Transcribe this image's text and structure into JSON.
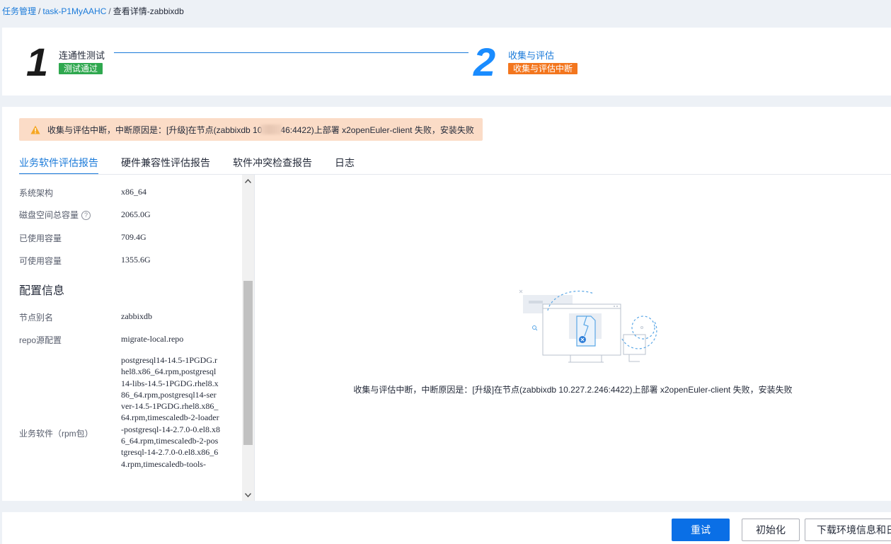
{
  "breadcrumb": {
    "items": [
      "任务管理",
      "task-P1MyAAHC",
      "查看详情-zabbixdb"
    ],
    "separator": "/"
  },
  "steps": [
    {
      "number": "1",
      "title": "连通性测试",
      "badge": "测试通过",
      "badge_color": "#2fa84f"
    },
    {
      "number": "2",
      "title": "收集与评估",
      "badge": "收集与评估中断",
      "badge_color": "#f3761e"
    }
  ],
  "alert": {
    "icon": "warning-icon",
    "text_before": "收集与评估中断，中断原因是：[升级]在节点(zabbixdb 10",
    "text_after": "46:4422)上部署 x2openEuler-client 失败，安装失败"
  },
  "tabs": [
    {
      "label": "业务软件评估报告",
      "active": true
    },
    {
      "label": "硬件兼容性评估报告",
      "active": false
    },
    {
      "label": "软件冲突检查报告",
      "active": false
    },
    {
      "label": "日志",
      "active": false
    }
  ],
  "info": {
    "arch_label": "系统架构",
    "arch_value": "x86_64",
    "disk_total_label": "磁盘空间总容量",
    "disk_total_value": "2065.0G",
    "disk_used_label": "已使用容量",
    "disk_used_value": "709.4G",
    "disk_free_label": "可使用容量",
    "disk_free_value": "1355.6G",
    "config_title": "配置信息",
    "alias_label": "节点别名",
    "alias_value": "zabbixdb",
    "repo_label": "repo源配置",
    "repo_value": "migrate-local.repo",
    "rpm_label": "业务软件（rpm包）",
    "rpm_value": "postgresql14-14.5-1PGDG.rhel8.x86_64.rpm,postgresql14-libs-14.5-1PGDG.rhel8.x86_64.rpm,postgresql14-server-14.5-1PGDG.rhel8.x86_64.rpm,timescaledb-2-loader-postgresql-14-2.7.0-0.el8.x86_64.rpm,timescaledb-2-postgresql-14-2.7.0-0.el8.x86_64.rpm,timescaledb-tools-"
  },
  "empty_state": {
    "message": "收集与评估中断，中断原因是：[升级]在节点(zabbixdb 10.227.2.246:4422)上部署 x2openEuler-client 失败，安装失败"
  },
  "footer": {
    "retry_label": "重试",
    "init_label": "初始化",
    "download_label": "下载环境信息和日志"
  },
  "colors": {
    "accent": "#1a7ad9",
    "success": "#2fa84f",
    "warning": "#f3761e",
    "alert_bg": "#fbdcc7",
    "primary_button": "#0a6fe6"
  }
}
